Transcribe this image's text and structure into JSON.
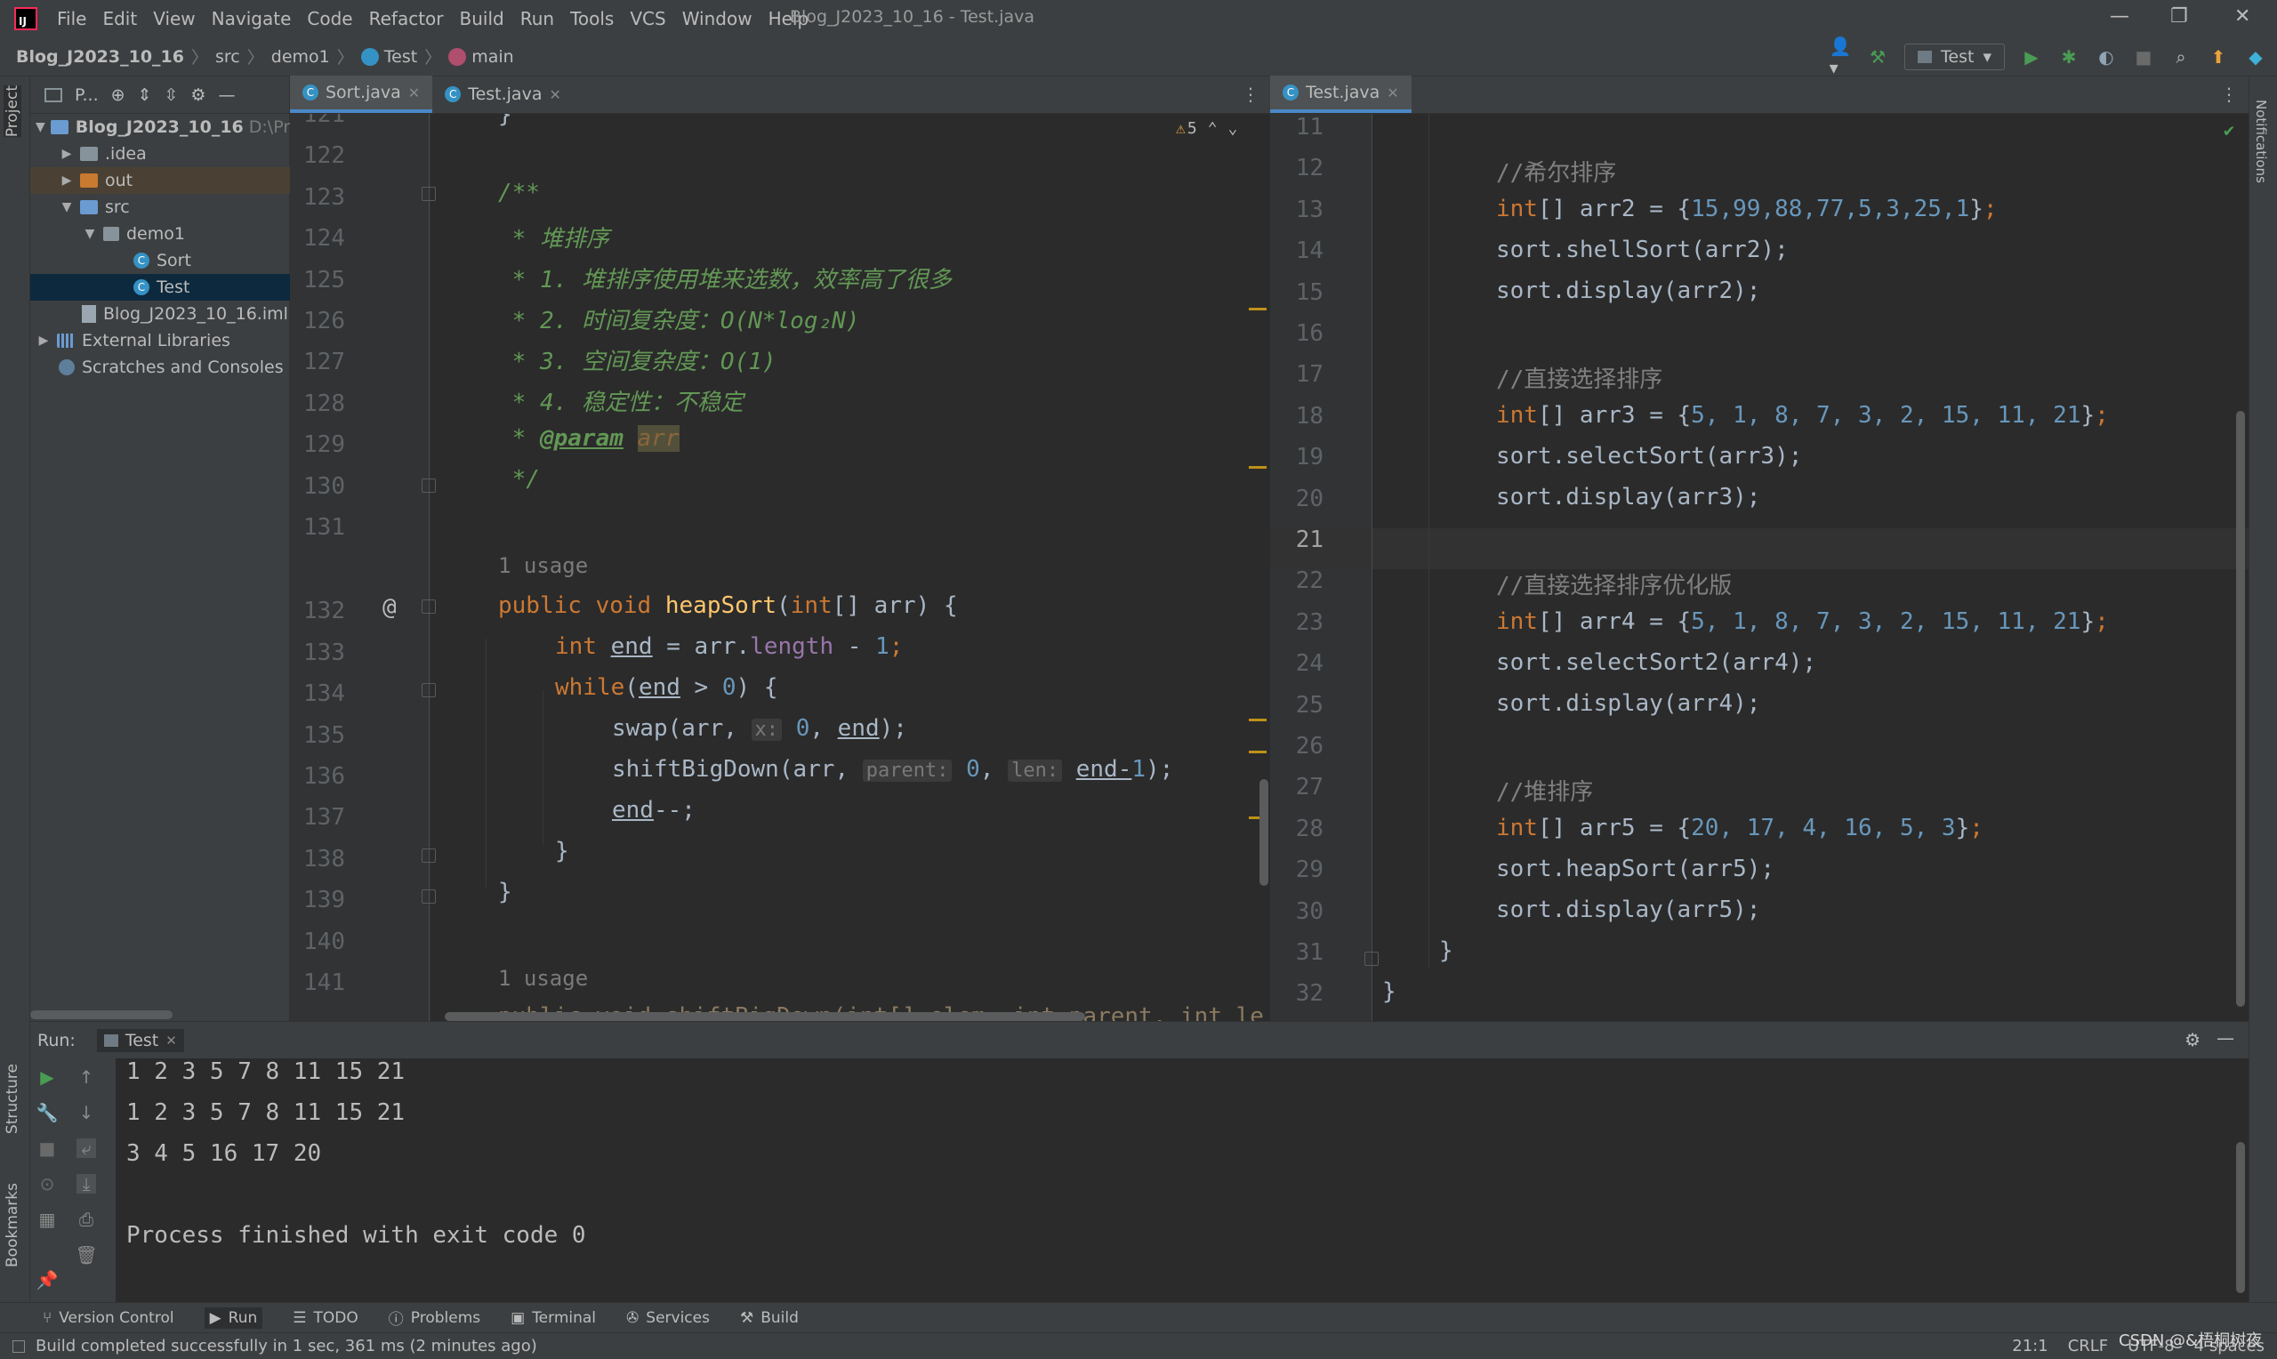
{
  "app": {
    "menu": [
      "File",
      "Edit",
      "View",
      "Navigate",
      "Code",
      "Refactor",
      "Build",
      "Run",
      "Tools",
      "VCS",
      "Window",
      "Help"
    ],
    "window_title": "Blog_J2023_10_16 - Test.java",
    "window_controls": [
      "—",
      "❐",
      "✕"
    ]
  },
  "breadcrumb": {
    "project": "Blog_J2023_10_16",
    "src": "src",
    "package": "demo1",
    "class": "Test",
    "method": "main"
  },
  "toolbar": {
    "run_config": "Test",
    "colors": {
      "run": "#499c54",
      "debug": "#499c54",
      "accent": "#4a88c7"
    }
  },
  "left_strip": {
    "project_tab": "Project",
    "structure_tab": "Structure",
    "bookmarks_tab": "Bookmarks"
  },
  "right_strip": {
    "notifications_tab": "Notifications"
  },
  "project_panel": {
    "title": "P...",
    "tree": [
      {
        "label": "Blog_J2023_10_16",
        "extra": "D:\\Proj"
      },
      {
        "label": ".idea"
      },
      {
        "label": "out"
      },
      {
        "label": "src"
      },
      {
        "label": "demo1"
      },
      {
        "label": "Sort"
      },
      {
        "label": "Test"
      },
      {
        "label": "Blog_J2023_10_16.iml"
      },
      {
        "label": "External Libraries"
      },
      {
        "label": "Scratches and Consoles"
      }
    ]
  },
  "left_editor": {
    "tabs": [
      {
        "label": "Sort.java"
      },
      {
        "label": "Test.java"
      }
    ],
    "warning_count": "5",
    "line_numbers": [
      "121",
      "122",
      "123",
      "124",
      "125",
      "126",
      "127",
      "128",
      "129",
      "130",
      "131",
      "132",
      "133",
      "134",
      "135",
      "136",
      "137",
      "138",
      "139",
      "140",
      "141"
    ],
    "usage_label": "1 usage",
    "doc": {
      "open": "/**",
      "l1": " * 堆排序",
      "l2": " * 1. 堆排序使用堆来选数，效率高了很多",
      "l3": " * 2. 时间复杂度：O(N*log₂N)",
      "l4": " * 3. 空间复杂度：O(1)",
      "l5": " * 4. 稳定性：不稳定",
      "star": " * ",
      "param_tag": "@param",
      "param_name": "arr",
      "close": " */"
    },
    "code": {
      "l121": "}",
      "public": "public",
      "void": "void",
      "heap_name": "heapSort",
      "int": "int",
      "heap_params": "[] arr) {",
      "end_var": "end",
      "arr_len_a": " = arr.",
      "length": "length",
      "minus": " - ",
      "one": "1",
      "semi": ";",
      "while": "while",
      "paren_open": "(",
      "gt": " > ",
      "zero": "0",
      "while_close": ") {",
      "swap": "swap(arr, ",
      "hint_x": "x:",
      "comma_sp": ", ",
      "close_semi": ");",
      "shift": "shiftBigDown(arr, ",
      "hint_parent": "parent:",
      "hint_len": "len:",
      "end_minus": "end-",
      "decr": "end",
      "decr_tail": "--;",
      "brace": "}",
      "l141": "public void shiftBigDown(int[] elem, int parent, int le"
    }
  },
  "right_editor": {
    "tab": "Test.java",
    "line_numbers": [
      "11",
      "12",
      "13",
      "14",
      "15",
      "16",
      "17",
      "18",
      "19",
      "20",
      "21",
      "22",
      "23",
      "24",
      "25",
      "26",
      "27",
      "28",
      "29",
      "30",
      "31",
      "32"
    ],
    "current_line": "21",
    "lines": {
      "c12": "//希尔排序",
      "c17": "//直接选择排序",
      "c22": "//直接选择排序优化版",
      "c27": "//堆排序",
      "int": "int",
      "arr2_decl": "[] arr2 = {",
      "arr2_vals": "15,99,88,77,5,3,25,1",
      "arr3_decl": "[] arr3 = {",
      "arr3_vals": "5, 1, 8, 7, 3, 2, 15, 11, 21",
      "arr4_decl": "[] arr4 = {",
      "arr4_vals": "5, 1, 8, 7, 3, 2, 15, 11, 21",
      "arr5_decl": "[] arr5 = {",
      "arr5_vals": "20, 17, 4, 16, 5, 3",
      "close_arr": "}",
      "semi": ";",
      "l14": "sort.shellSort(arr2);",
      "l15": "sort.display(arr2);",
      "l19": "sort.selectSort(arr3);",
      "l20": "sort.display(arr3);",
      "l24": "sort.selectSort2(arr4);",
      "l25": "sort.display(arr4);",
      "l29": "sort.heapSort(arr5);",
      "l30": "sort.display(arr5);",
      "l31": "}",
      "l32": "}"
    }
  },
  "run_panel": {
    "label": "Run:",
    "tab": "Test",
    "output": [
      "1 2 3 5 7 8 11 15 21",
      "1 2 3 5 7 8 11 15 21",
      "3 4 5 16 17 20",
      "",
      "Process finished with exit code 0"
    ]
  },
  "tool_windows": [
    "Version Control",
    "Run",
    "TODO",
    "Problems",
    "Terminal",
    "Services",
    "Build"
  ],
  "status": {
    "message": "Build completed successfully in 1 sec, 361 ms (2 minutes ago)",
    "position": "21:1",
    "line_sep": "CRLF",
    "encoding": "UTF-8",
    "indent": "4 spaces",
    "watermark": "CSDN @&梧桐树夜"
  }
}
